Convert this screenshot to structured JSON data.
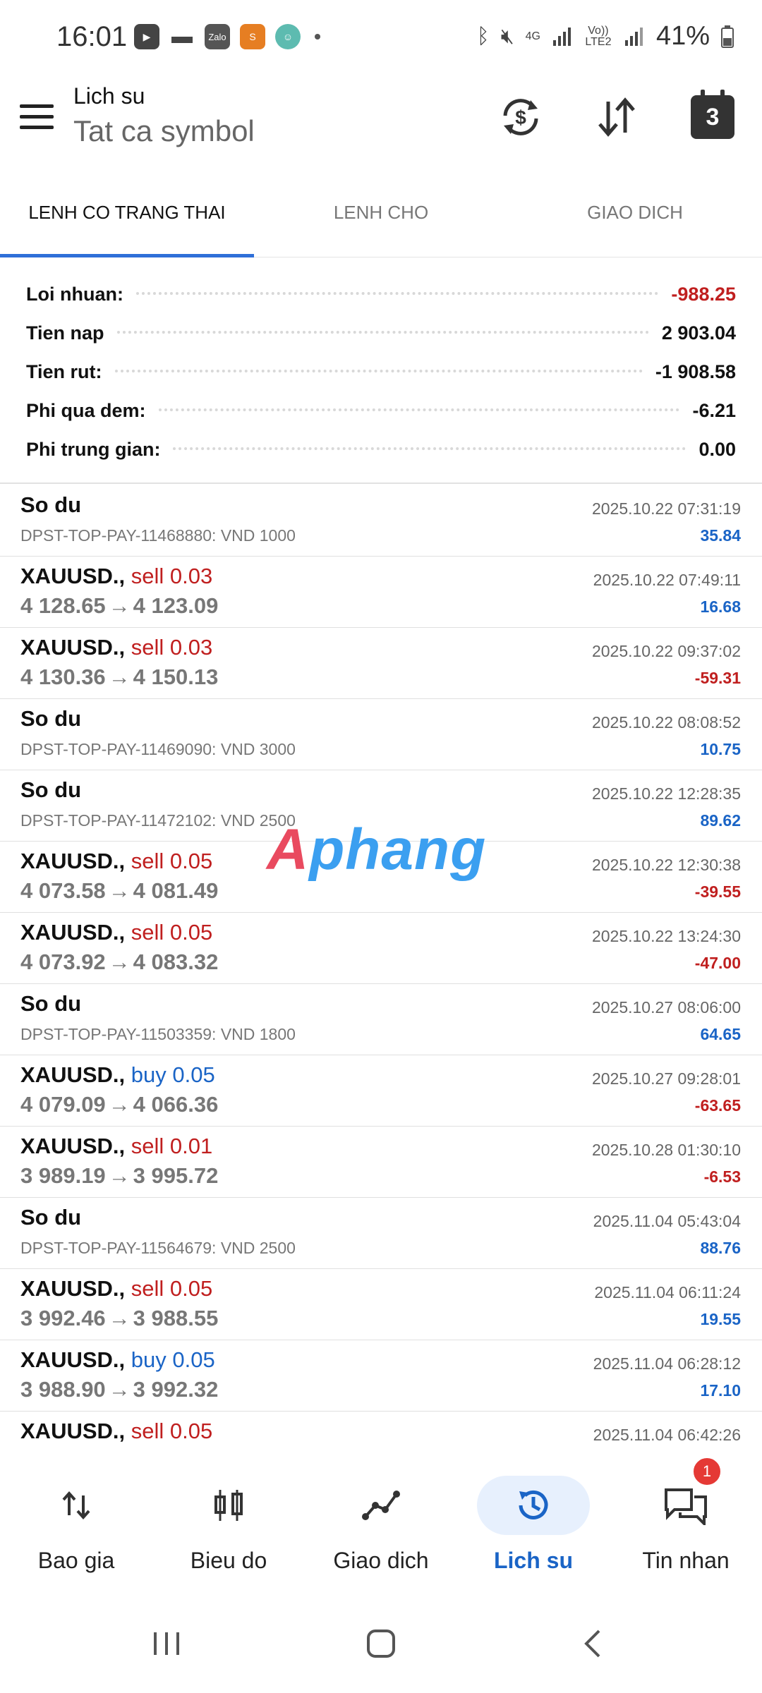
{
  "status_bar": {
    "time": "16:01",
    "app_icons": [
      "youtube-icon",
      "message-icon",
      "zalo-icon",
      "sendo-icon",
      "avatar-app-icon"
    ],
    "zalo_label": "Zalo",
    "network_4g": "4G",
    "volte_label": "Vo)) LTE2",
    "battery": "41%"
  },
  "header": {
    "title": "Lich su",
    "subtitle": "Tat ca symbol",
    "calendar_day": "3"
  },
  "tabs": [
    {
      "label": "LENH CO TRANG THAI",
      "active": true
    },
    {
      "label": "LENH CHO",
      "active": false
    },
    {
      "label": "GIAO DICH",
      "active": false
    }
  ],
  "summary": [
    {
      "label": "Loi nhuan:",
      "value": "-988.25",
      "color": "#c01f1f"
    },
    {
      "label": "Tien nap",
      "value": "2 903.04",
      "color": "#111111"
    },
    {
      "label": "Tien rut:",
      "value": "-1 908.58",
      "color": "#111111"
    },
    {
      "label": "Phi qua dem:",
      "value": "-6.21",
      "color": "#111111"
    },
    {
      "label": "Phi trung gian:",
      "value": "0.00",
      "color": "#111111"
    }
  ],
  "items": [
    {
      "type": "balance",
      "title": "So du",
      "sub": "DPST-TOP-PAY-11468880: VND 1000",
      "date": "2025.10.22 07:31:19",
      "profit": "35.84",
      "profit_color": "blue"
    },
    {
      "type": "trade",
      "symbol": "XAUUSD.,",
      "action": "sell 0.03",
      "action_color": "red",
      "open": "4 128.65",
      "close": "4 123.09",
      "date": "2025.10.22 07:49:11",
      "profit": "16.68",
      "profit_color": "blue"
    },
    {
      "type": "trade",
      "symbol": "XAUUSD.,",
      "action": "sell 0.03",
      "action_color": "red",
      "open": "4 130.36",
      "close": "4 150.13",
      "date": "2025.10.22 09:37:02",
      "profit": "-59.31",
      "profit_color": "red"
    },
    {
      "type": "balance",
      "title": "So du",
      "sub": "DPST-TOP-PAY-11469090: VND 3000",
      "date": "2025.10.22 08:08:52",
      "profit": "10.75",
      "profit_color": "blue"
    },
    {
      "type": "balance",
      "title": "So du",
      "sub": "DPST-TOP-PAY-11472102: VND 2500",
      "date": "2025.10.22 12:28:35",
      "profit": "89.62",
      "profit_color": "blue"
    },
    {
      "type": "trade",
      "symbol": "XAUUSD.,",
      "action": "sell 0.05",
      "action_color": "red",
      "open": "4 073.58",
      "close": "4 081.49",
      "date": "2025.10.22 12:30:38",
      "profit": "-39.55",
      "profit_color": "red"
    },
    {
      "type": "trade",
      "symbol": "XAUUSD.,",
      "action": "sell 0.05",
      "action_color": "red",
      "open": "4 073.92",
      "close": "4 083.32",
      "date": "2025.10.22 13:24:30",
      "profit": "-47.00",
      "profit_color": "red"
    },
    {
      "type": "balance",
      "title": "So du",
      "sub": "DPST-TOP-PAY-11503359: VND 1800",
      "date": "2025.10.27 08:06:00",
      "profit": "64.65",
      "profit_color": "blue"
    },
    {
      "type": "trade",
      "symbol": "XAUUSD.,",
      "action": "buy 0.05",
      "action_color": "blue",
      "open": "4 079.09",
      "close": "4 066.36",
      "date": "2025.10.27 09:28:01",
      "profit": "-63.65",
      "profit_color": "red"
    },
    {
      "type": "trade",
      "symbol": "XAUUSD.,",
      "action": "sell 0.01",
      "action_color": "red",
      "open": "3 989.19",
      "close": "3 995.72",
      "date": "2025.10.28 01:30:10",
      "profit": "-6.53",
      "profit_color": "red"
    },
    {
      "type": "balance",
      "title": "So du",
      "sub": "DPST-TOP-PAY-11564679: VND 2500",
      "date": "2025.11.04 05:43:04",
      "profit": "88.76",
      "profit_color": "blue"
    },
    {
      "type": "trade",
      "symbol": "XAUUSD.,",
      "action": "sell 0.05",
      "action_color": "red",
      "open": "3 992.46",
      "close": "3 988.55",
      "date": "2025.11.04 06:11:24",
      "profit": "19.55",
      "profit_color": "blue"
    },
    {
      "type": "trade",
      "symbol": "XAUUSD.,",
      "action": "buy 0.05",
      "action_color": "blue",
      "open": "3 988.90",
      "close": "3 992.32",
      "date": "2025.11.04 06:28:12",
      "profit": "17.10",
      "profit_color": "blue"
    },
    {
      "type": "trade",
      "symbol": "XAUUSD.,",
      "action": "sell 0.05",
      "action_color": "red",
      "open": "",
      "close": "",
      "date": "2025.11.04 06:42:26",
      "profit": "",
      "profit_color": "blue"
    }
  ],
  "arrow_glyph": "→",
  "watermark": {
    "part1": "A",
    "part2": "phang"
  },
  "bottom_nav": [
    {
      "label": "Bao gia",
      "icon": "quotes-icon",
      "active": false
    },
    {
      "label": "Bieu do",
      "icon": "chart-icon",
      "active": false
    },
    {
      "label": "Giao dich",
      "icon": "trade-icon",
      "active": false
    },
    {
      "label": "Lich su",
      "icon": "history-icon",
      "active": true
    },
    {
      "label": "Tin nhan",
      "icon": "messages-icon",
      "active": false,
      "badge": "1"
    }
  ],
  "colors": {
    "accent": "#2f6fd8",
    "profit": "#1a64c6",
    "loss": "#c01f1f"
  }
}
